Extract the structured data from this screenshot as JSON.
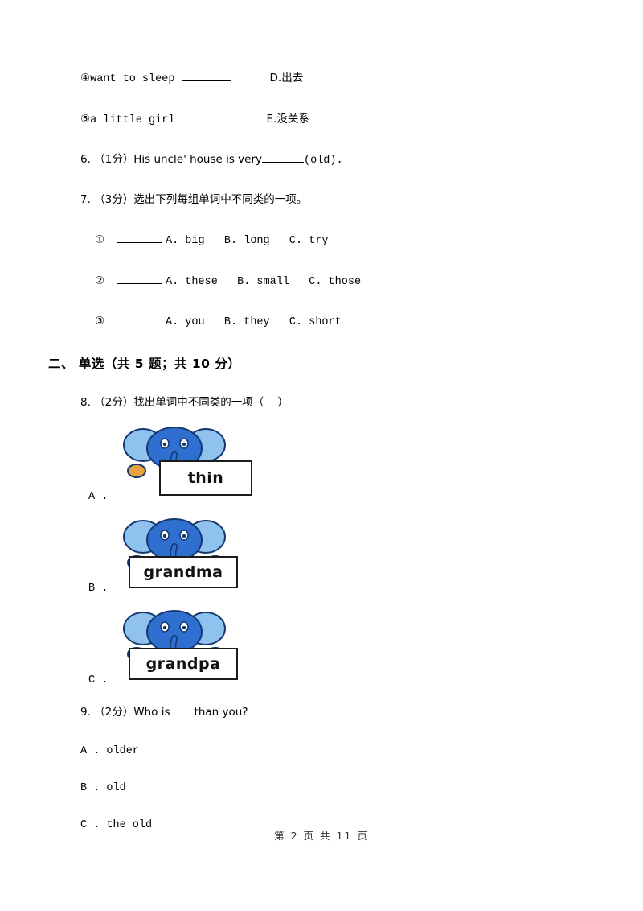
{
  "document": {
    "lines": {
      "item4": "④want to sleep ",
      "item4_match": "D.出去",
      "item5": "⑤a little girl ",
      "item5_match": "E.没关系",
      "q6": "6. （1分）His uncle' house is very",
      "q6_tail": "(old).",
      "q7": "7. （3分）选出下列每组单词中不同类的一项。",
      "q7_o1_num": "①",
      "q7_o1": "A. big   B. long   C. try",
      "q7_o2_num": "②",
      "q7_o2": "A. these   B. small   C. those",
      "q7_o3_num": "③",
      "q7_o3": "A. you   B. they   C. short",
      "section2": "二、 单选（共 5 题；共 10 分）",
      "q8": "8. （2分）找出单词中不同类的一项（    ）",
      "q8_a_tag": "A .",
      "q8_a_word": "thin",
      "q8_b_tag": "B .",
      "q8_b_word": "grandma",
      "q8_c_tag": "C .",
      "q8_c_word": "grandpa",
      "q9": "9. （2分）Who is       than you?",
      "q9_a": "A . older",
      "q9_b": "B . old",
      "q9_c": "C . the old"
    },
    "footer": {
      "text": "第 2 页 共 11 页"
    },
    "colors": {
      "elephant_body": "#2f6fd0",
      "elephant_light": "#8fc2ef",
      "elephant_outline": "#14386e",
      "foot": "#e8a33d"
    }
  }
}
